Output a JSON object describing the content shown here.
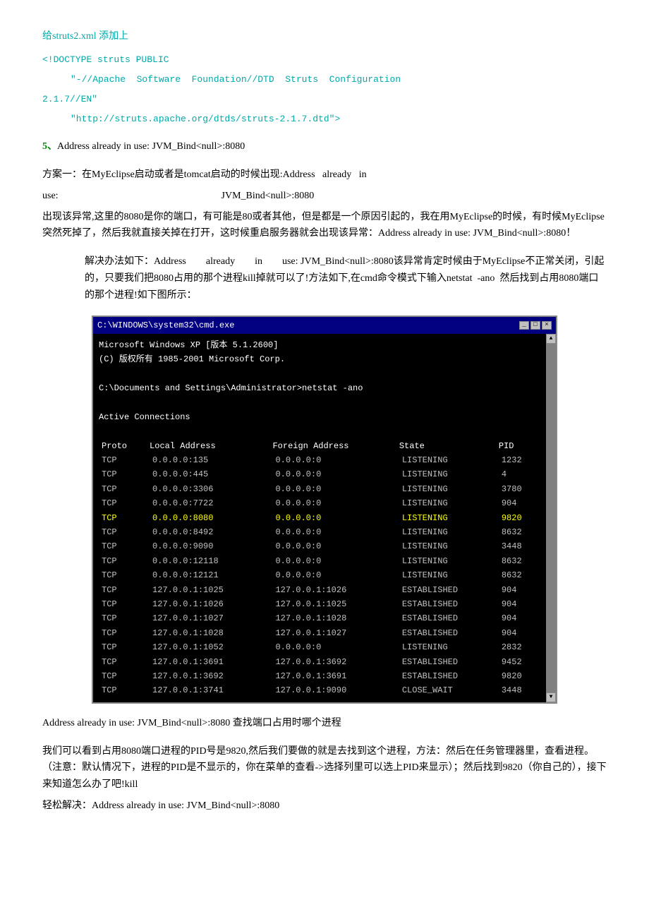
{
  "intro_line": "给struts2.xml  添加上",
  "doctype_lines": [
    "<!DOCTYPE struts PUBLIC",
    "    \"-//Apache  Software  Foundation//DTD  Struts  Configuration",
    "2.1.7//EN\"",
    "    \"http://struts.apache.org/dtds/struts-2.1.7.dtd\">"
  ],
  "section5_heading": "5、Address already in use: JVM_Bind<null>:8080",
  "solution_para1": "方案一：在MyEclipse启动或者是tomcat启动的时候出现:Address   already   in",
  "solution_para2": "use:                                                              JVM_Bind<null>:8080",
  "solution_para3": "出现该异常,这里的8080是你的端口，有可能是80或者其他，但是都是一个原因引起的，我在用MyEclipse的时候，有时候MyEclipse突然死掉了，然后我就直接关掉在打开，这时候重启服务器就会出现该异常：Address already in use: JVM_Bind<null>:8080！",
  "solution_para4_indent": "解决办法如下：Address        already        in        use: JVM_Bind<null>:8080该异常肯定时候由于MyEclipse不正常关闭，引起的，只要我们把8080占用的那个进程kill掉就可以了!方法如下,在cmd命令模式下输入netstat  -ano  然后找到占用8080端口的那个进程!如下图所示：",
  "cmd": {
    "titlebar": "C:\\WINDOWS\\system32\\cmd.exe",
    "controls": [
      "_",
      "□",
      "×"
    ],
    "line1": "Microsoft Windows XP [版本 5.1.2600]",
    "line2": "(C) 版权所有 1985-2001 Microsoft Corp.",
    "line3": "",
    "line4": "C:\\Documents and Settings\\Administrator>netstat -ano",
    "line5": "",
    "line6": "Active Connections",
    "line7": "",
    "col_headers": [
      "Proto",
      "Local Address",
      "Foreign Address",
      "State",
      "PID"
    ],
    "rows": [
      [
        "TCP",
        "0.0.0.0:135",
        "0.0.0.0:0",
        "LISTENING",
        "1232"
      ],
      [
        "TCP",
        "0.0.0.0:445",
        "0.0.0.0:0",
        "LISTENING",
        "4"
      ],
      [
        "TCP",
        "0.0.0.0:3306",
        "0.0.0.0:0",
        "LISTENING",
        "3780"
      ],
      [
        "TCP",
        "0.0.0.0:7722",
        "0.0.0.0:0",
        "LISTENING",
        "904"
      ],
      [
        "TCP",
        "0.0.0.0:8080",
        "0.0.0.0:0",
        "LISTENING",
        "9820"
      ],
      [
        "TCP",
        "0.0.0.0:8492",
        "0.0.0.0:0",
        "LISTENING",
        "8632"
      ],
      [
        "TCP",
        "0.0.0.0:9090",
        "0.0.0.0:0",
        "LISTENING",
        "3448"
      ],
      [
        "TCP",
        "0.0.0.0:12118",
        "0.0.0.0:0",
        "LISTENING",
        "8632"
      ],
      [
        "TCP",
        "0.0.0.0:12121",
        "0.0.0.0:0",
        "LISTENING",
        "8632"
      ],
      [
        "TCP",
        "127.0.0.1:1025",
        "127.0.0.1:1026",
        "ESTABLISHED",
        "904"
      ],
      [
        "TCP",
        "127.0.0.1:1026",
        "127.0.0.1:1025",
        "ESTABLISHED",
        "904"
      ],
      [
        "TCP",
        "127.0.0.1:1027",
        "127.0.0.1:1028",
        "ESTABLISHED",
        "904"
      ],
      [
        "TCP",
        "127.0.0.1:1028",
        "127.0.0.1:1027",
        "ESTABLISHED",
        "904"
      ],
      [
        "TCP",
        "127.0.0.1:1052",
        "0.0.0.0:0",
        "LISTENING",
        "2832"
      ],
      [
        "TCP",
        "127.0.0.1:3691",
        "127.0.0.1:3692",
        "ESTABLISHED",
        "9452"
      ],
      [
        "TCP",
        "127.0.0.1:3692",
        "127.0.0.1:3691",
        "ESTABLISHED",
        "9820"
      ],
      [
        "TCP",
        "127.0.0.1:3741",
        "127.0.0.1:9090",
        "CLOSE_WAIT",
        "3448"
      ]
    ]
  },
  "caption": "Address already in use: JVM_Bind<null>:8080 查找端口占用时哪个进程",
  "final_para": "我们可以看到占用8080端口进程的PID号是9820,然后我们要做的就是去找到这个进程，方法：然后在任务管理器里，查看进程。（注意：默认情况下，进程的PID是不显示的，你在菜单的查看->选择列里可以选上PID来显示）；然后找到9820（你自己的），接下来知道怎么办了吧!kill",
  "final_line2": "轻松解决：Address already in use: JVM_Bind<null>:8080"
}
